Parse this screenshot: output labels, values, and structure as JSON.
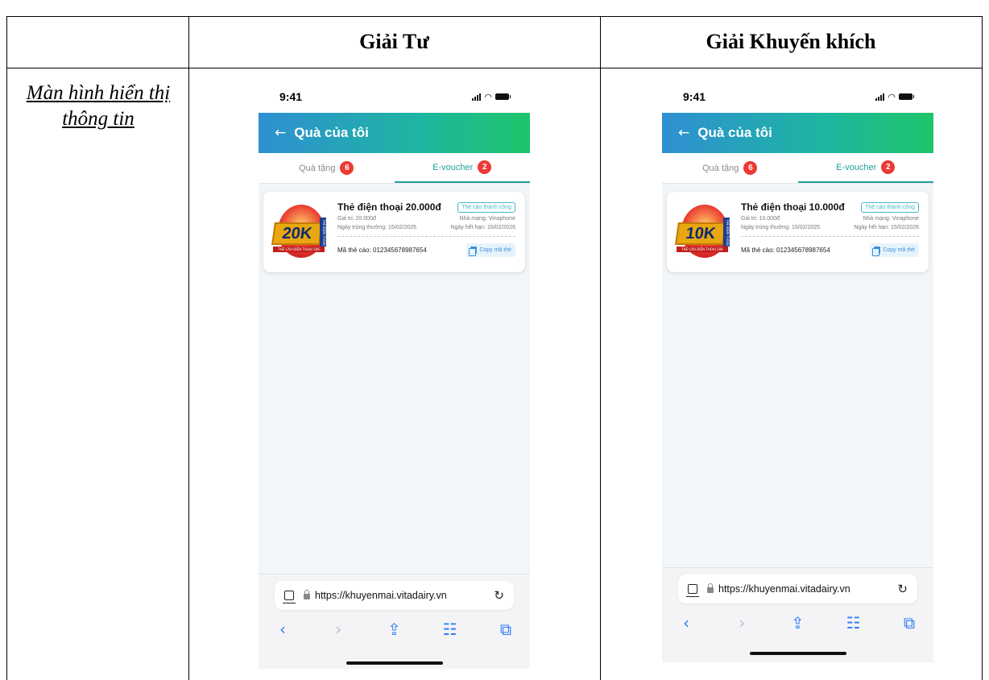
{
  "table": {
    "header": {
      "col1": "",
      "col2": "Giải Tư",
      "col3": "Giải Khuyến khích"
    },
    "row_label": "Màn hình hiển thị thông tin"
  },
  "phones": [
    {
      "status_time": "9:41",
      "header_title": "Quà của tôi",
      "back_icon": "←",
      "tabs": [
        {
          "label": "Quà tặng",
          "count": "6"
        },
        {
          "label": "E-voucher",
          "count": "2"
        }
      ],
      "card": {
        "thumb_amount": "20K",
        "thumb_ribbon": "THẺ CÀO ĐIỆN THOẠI 20K",
        "thumb_side": "THẺ ĐIỆN THOẠI",
        "title": "Thẻ điện thoại 20.000đ",
        "status": "Thẻ cào thành công",
        "value": "Giá trị: 20.000đ",
        "network": "Nhà mạng: Vinaphone",
        "win_date": "Ngày trúng thưởng: 15/02/2025",
        "expire_date": "Ngày hết hạn: 15/02/2026",
        "code": "Mã thẻ cào: 012345678987654",
        "copy_label": "Copy mã thẻ"
      },
      "url": "https://khuyenmai.vitadairy.vn"
    },
    {
      "status_time": "9:41",
      "header_title": "Quà của tôi",
      "back_icon": "←",
      "tabs": [
        {
          "label": "Quà tặng",
          "count": "6"
        },
        {
          "label": "E-voucher",
          "count": "2"
        }
      ],
      "card": {
        "thumb_amount": "10K",
        "thumb_ribbon": "THẺ CÀO ĐIỆN THOẠI 10K",
        "thumb_side": "THẺ ĐIỆN THOẠI",
        "title": "Thẻ điện thoại 10.000đ",
        "status": "Thẻ cào thành công",
        "value": "Giá trị: 10.000đ",
        "network": "Nhà mạng: Vinaphone",
        "win_date": "Ngày trúng thưởng: 15/02/2025",
        "expire_date": "Ngày hết hạn: 15/02/2026",
        "code": "Mã thẻ cào: 012345678987654",
        "copy_label": "Copy mã thẻ"
      },
      "url": "https://khuyenmai.vitadairy.vn"
    }
  ],
  "icons": {
    "nav_back": "back-chevron-icon",
    "nav_forward": "forward-chevron-icon",
    "share": "share-icon",
    "bookmarks": "bookmarks-icon",
    "tabs": "tabs-icon",
    "reload": "reload-icon"
  },
  "colors": {
    "header_start": "#2f8fd3",
    "header_end": "#1ec56a",
    "accent": "#1fa39a",
    "badge": "#ec3a34",
    "link_blue": "#2f7cf6"
  }
}
